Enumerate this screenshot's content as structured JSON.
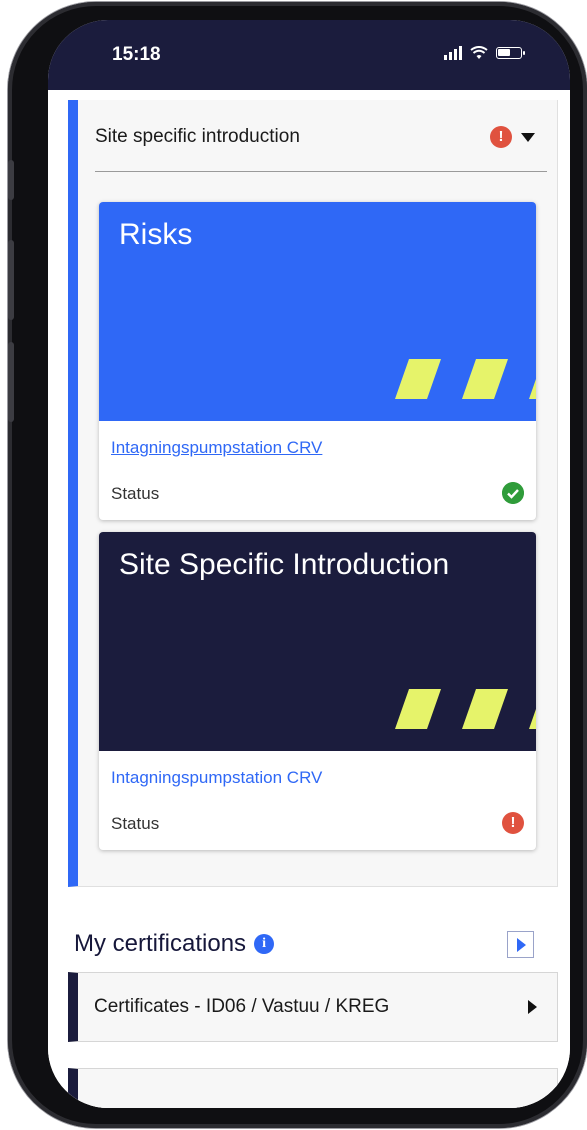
{
  "status_bar": {
    "time": "15:18"
  },
  "site_intro": {
    "title": "Site specific introduction"
  },
  "cards": [
    {
      "title": "Risks",
      "link": "Intagningspumpstation CRV",
      "status_label": "Status",
      "status": "ok",
      "hero_color": "#2f68f6"
    },
    {
      "title": "Site Specific Introduction",
      "link": "Intagningspumpstation CRV",
      "status_label": "Status",
      "status": "alert",
      "hero_color": "#1b1c3d"
    }
  ],
  "certifications": {
    "title": "My certifications",
    "rows": [
      {
        "label": "Certificates - ID06 / Vastuu / KREG"
      }
    ]
  },
  "colors": {
    "accent": "#2f68f6",
    "dark": "#1b1c3d",
    "stripe": "#e6f36a",
    "alert": "#e0523f",
    "ok": "#2f9c3a"
  },
  "icons": {
    "alert": "!",
    "info": "i"
  }
}
